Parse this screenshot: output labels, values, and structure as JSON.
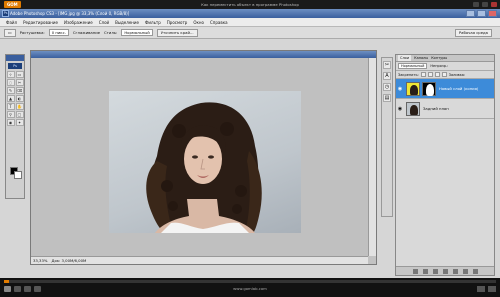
{
  "player": {
    "logo": "GOM",
    "title": "Как переместить объект в программе Photoshop",
    "site": "www.gomlab.com",
    "progress_fraction": 0.01
  },
  "photoshop": {
    "app_icon": "Ps",
    "title": "Adobe Photoshop CS3 - [IMG.jpg @ 33,3% (Слой 0, RGB/8)]",
    "menu": [
      "Файл",
      "Редактирование",
      "Изображение",
      "Слой",
      "Выделение",
      "Фильтр",
      "Просмотр",
      "Окно",
      "Справка"
    ],
    "options": {
      "feather_label": "Растушевка:",
      "feather_value": "0 пикс.",
      "antialias_label": "Сглаживание",
      "style_label": "Стиль:",
      "style_value": "Нормальный",
      "refine_button": "Уточнить край...",
      "workspace_button": "Рабочая среда"
    },
    "toolbox": {
      "tools": [
        "⊹",
        "▭",
        "◌",
        "✂",
        "✎",
        "⌫",
        "▲",
        "◐",
        "T",
        "✋",
        "⚲",
        "▢",
        "◉",
        "✦"
      ]
    },
    "document": {
      "zoom": "33,33%",
      "doc_info": "Док: 3,00M/6,00M"
    },
    "layers_panel": {
      "tabs": [
        "Слои",
        "Каналы",
        "Контуры"
      ],
      "blend_mode": "Нормальный",
      "opacity_label": "Непрозр.:",
      "lock_label": "Закрепить:",
      "fill_label": "Заливка:",
      "layers": [
        {
          "name": "Новый слой (копия)",
          "active": true,
          "has_mask": true
        },
        {
          "name": "Задний план",
          "active": false,
          "has_mask": false
        }
      ]
    },
    "colors": {
      "accent": "#3d8bd9",
      "title_bar": "#3a5f9e"
    }
  }
}
